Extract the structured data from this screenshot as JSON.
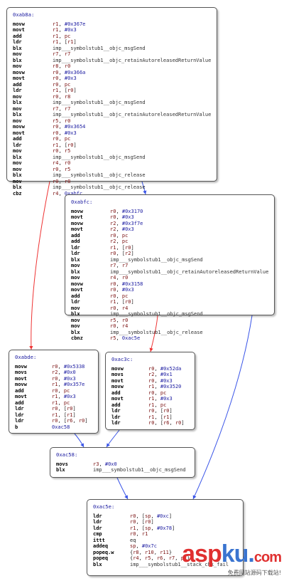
{
  "blocks": [
    {
      "label": "0xab8a:",
      "lines": [
        [
          "movw",
          "r1, #0x367e"
        ],
        [
          "movt",
          "r1, #0x3"
        ],
        [
          "add",
          "r1, pc"
        ],
        [
          "ldr",
          "r1, [r1]"
        ],
        [
          "blx",
          "imp___symbolstub1__objc_msgSend"
        ],
        [
          "mov",
          "r7, r7"
        ],
        [
          "blx",
          "imp___symbolstub1__objc_retainAutoreleasedReturnValue"
        ],
        [
          "mov",
          "r8, r0"
        ],
        [
          "movw",
          "r0, #0x366a"
        ],
        [
          "movt",
          "r0, #0x3"
        ],
        [
          "add",
          "r0, pc"
        ],
        [
          "ldr",
          "r1, [r0]"
        ],
        [
          "mov",
          "r0, r8"
        ],
        [
          "blx",
          "imp___symbolstub1__objc_msgSend"
        ],
        [
          "mov",
          "r7, r7"
        ],
        [
          "blx",
          "imp___symbolstub1__objc_retainAutoreleasedReturnValue"
        ],
        [
          "mov",
          "r5, r0"
        ],
        [
          "movw",
          "r0, #0x3654"
        ],
        [
          "movt",
          "r0, #0x3"
        ],
        [
          "add",
          "r0, pc"
        ],
        [
          "ldr",
          "r1, [r0]"
        ],
        [
          "mov",
          "r0, r5"
        ],
        [
          "blx",
          "imp___symbolstub1__objc_msgSend"
        ],
        [
          "mov",
          "r4, r0"
        ],
        [
          "mov",
          "r0, r5"
        ],
        [
          "blx",
          "imp___symbolstub1__objc_release"
        ],
        [
          "mov",
          "r0, r8"
        ],
        [
          "blx",
          "imp___symbolstub1__objc_release"
        ],
        [
          "cbz",
          "r4, 0xabfc"
        ]
      ]
    },
    {
      "label": "0xabfc:",
      "lines": [
        [
          "movw",
          "r0, #0x3170"
        ],
        [
          "movt",
          "r0, #0x3"
        ],
        [
          "movw",
          "r2, #0x3f7e"
        ],
        [
          "movt",
          "r2, #0x3"
        ],
        [
          "add",
          "r0, pc"
        ],
        [
          "add",
          "r2, pc"
        ],
        [
          "ldr",
          "r1, [r0]"
        ],
        [
          "ldr",
          "r0, [r2]"
        ],
        [
          "blx",
          "imp___symbolstub1__objc_msgSend"
        ],
        [
          "mov",
          "r7, r7"
        ],
        [
          "blx",
          "imp___symbolstub1__objc_retainAutoreleasedReturnValue"
        ],
        [
          "mov",
          "r4, r0"
        ],
        [
          "movw",
          "r0, #0x3158"
        ],
        [
          "movt",
          "r0, #0x3"
        ],
        [
          "add",
          "r0, pc"
        ],
        [
          "ldr",
          "r1, [r0]"
        ],
        [
          "mov",
          "r0, r4"
        ],
        [
          "blx",
          "imp___symbolstub1__objc_msgSend"
        ],
        [
          "mov",
          "r5, r0"
        ],
        [
          "mov",
          "r0, r4"
        ],
        [
          "blx",
          "imp___symbolstub1__objc_release"
        ],
        [
          "cbnz",
          "r5, 0xac5e"
        ]
      ]
    },
    {
      "label": "0xabde:",
      "lines": [
        [
          "movw",
          "r0, #0x5338"
        ],
        [
          "movs",
          "r2, #0x0"
        ],
        [
          "movt",
          "r0, #0x3"
        ],
        [
          "movw",
          "r1, #0x357e"
        ],
        [
          "add",
          "r0, pc"
        ],
        [
          "movt",
          "r1, #0x3"
        ],
        [
          "add",
          "r1, pc"
        ],
        [
          "ldr",
          "r0, [r0]"
        ],
        [
          "ldr",
          "r1, [r1]"
        ],
        [
          "ldr",
          "r0, [r6, r0]"
        ],
        [
          "b",
          "0xac58"
        ]
      ]
    },
    {
      "label": "0xac3c:",
      "lines": [
        [
          "movw",
          "r0, #0x52da"
        ],
        [
          "movs",
          "r2, #0x1"
        ],
        [
          "movt",
          "r0, #0x3"
        ],
        [
          "movw",
          "r1, #0x3520"
        ],
        [
          "add",
          "r0, pc"
        ],
        [
          "movt",
          "r1, #0x3"
        ],
        [
          "add",
          "r1, pc"
        ],
        [
          "ldr",
          "r0, [r0]"
        ],
        [
          "ldr",
          "r1, [r1]"
        ],
        [
          "ldr",
          "r0, [r6, r0]"
        ]
      ]
    },
    {
      "label": "0xac58:",
      "lines": [
        [
          "movs",
          "r3, #0x0"
        ],
        [
          "blx",
          "imp___symbolstub1__objc_msgSend"
        ]
      ]
    },
    {
      "label": "0xac5e:",
      "lines": [
        [
          "ldr",
          "r0, [sp, #0xc]"
        ],
        [
          "ldr",
          "r0, [r0]"
        ],
        [
          "ldr",
          "r1, [sp, #0x78]"
        ],
        [
          "cmp",
          "r0, r1"
        ],
        [
          "ittt",
          "eq"
        ],
        [
          "addeq",
          "sp, #0x7c"
        ],
        [
          "popeq.w",
          "{r8, r10, r11}"
        ],
        [
          "popeq",
          "{r4, r5, r6, r7, pc}"
        ],
        [
          "blx",
          "imp___symbolstub1__stack_chk_fail"
        ]
      ]
    }
  ],
  "edge_colors": {
    "true": "#ee3333",
    "false": "#3a55e8"
  },
  "watermark": {
    "asp": "asp",
    "ku": "ku",
    "dot": ".",
    "com": "com",
    "sub": "免费网站源码下载站!"
  }
}
